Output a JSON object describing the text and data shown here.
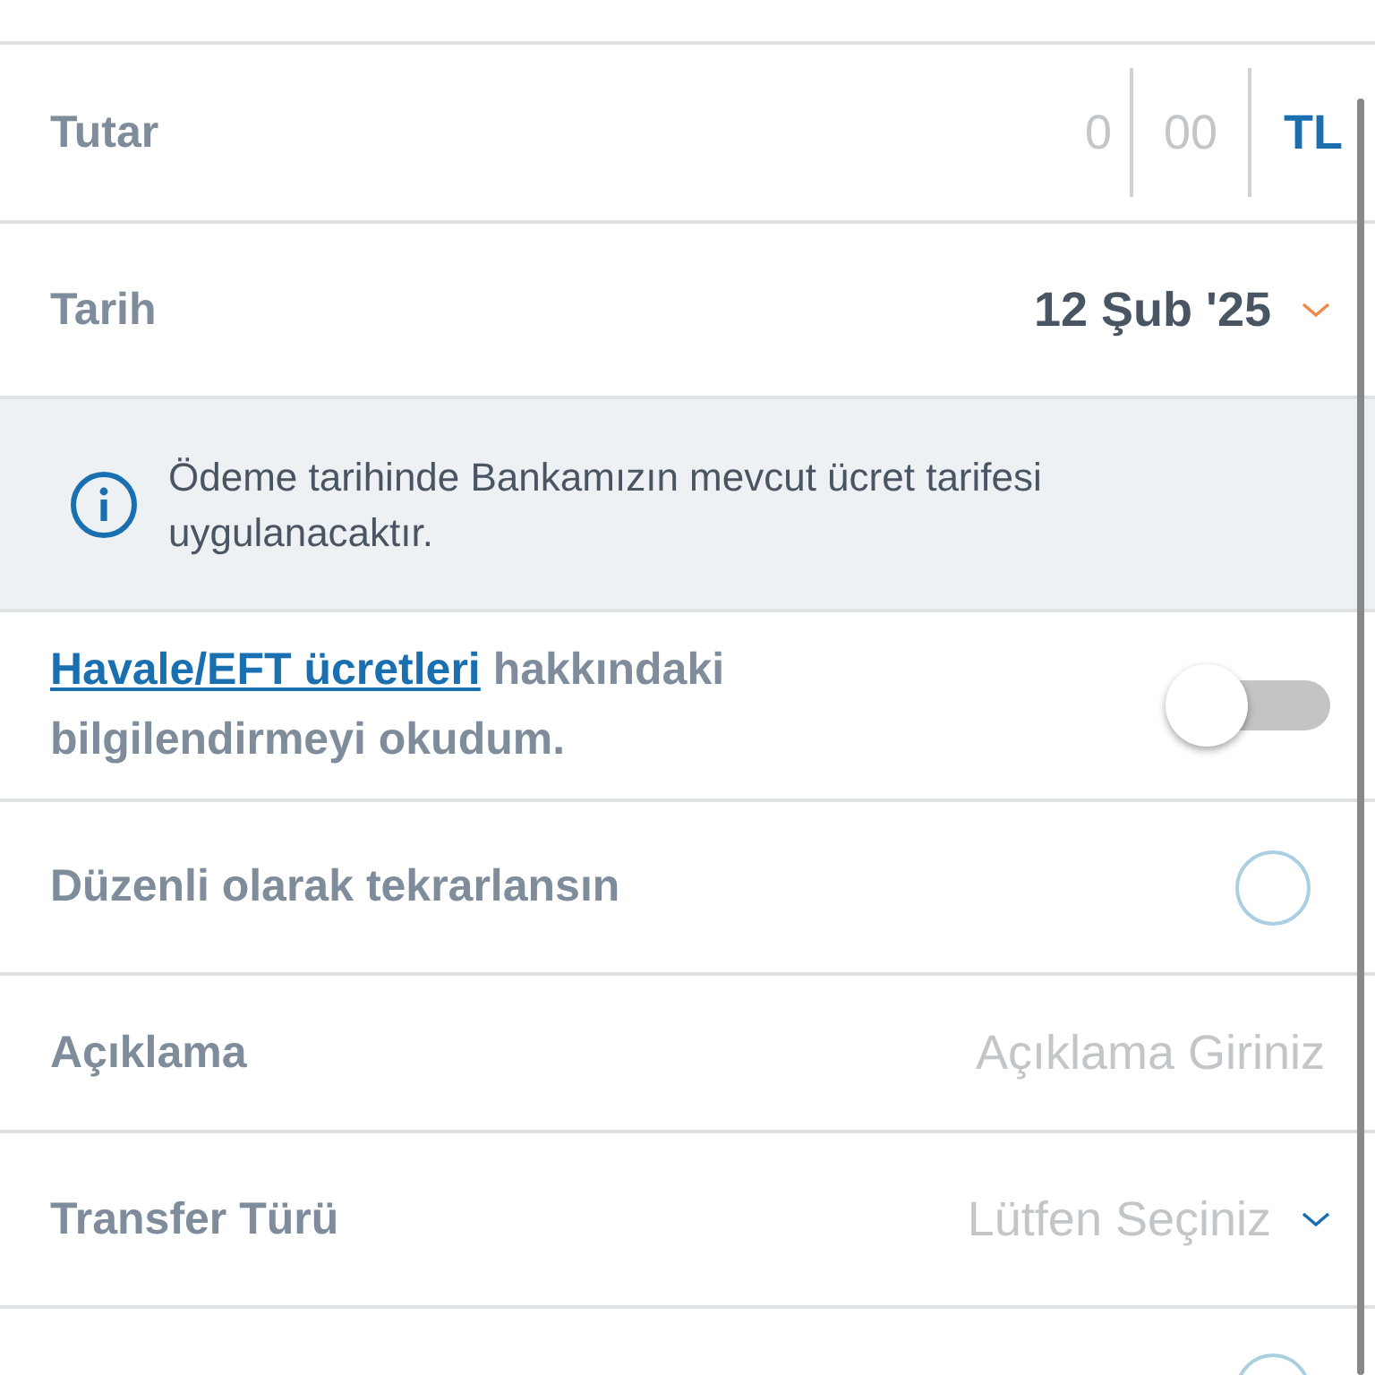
{
  "amount": {
    "label": "Tutar",
    "whole_placeholder": "0",
    "fraction_placeholder": "00",
    "currency": "TL"
  },
  "date": {
    "label": "Tarih",
    "value": "12 Şub '25"
  },
  "info": {
    "text": "Ödeme tarihinde Bankamızın mevcut ücret tarifesi uygulanacaktır."
  },
  "consent": {
    "link": "Havale/EFT ücretleri",
    "text": "hakkındaki bilgilendirmeyi okudum.",
    "on": false
  },
  "recurring": {
    "label": "Düzenli olarak tekrarlansın",
    "checked": false
  },
  "description": {
    "label": "Açıklama",
    "placeholder": "Açıklama Giriniz"
  },
  "transfer_type": {
    "label": "Transfer Türü",
    "placeholder": "Lütfen Seçiniz"
  },
  "last_row": {
    "checked": false
  }
}
